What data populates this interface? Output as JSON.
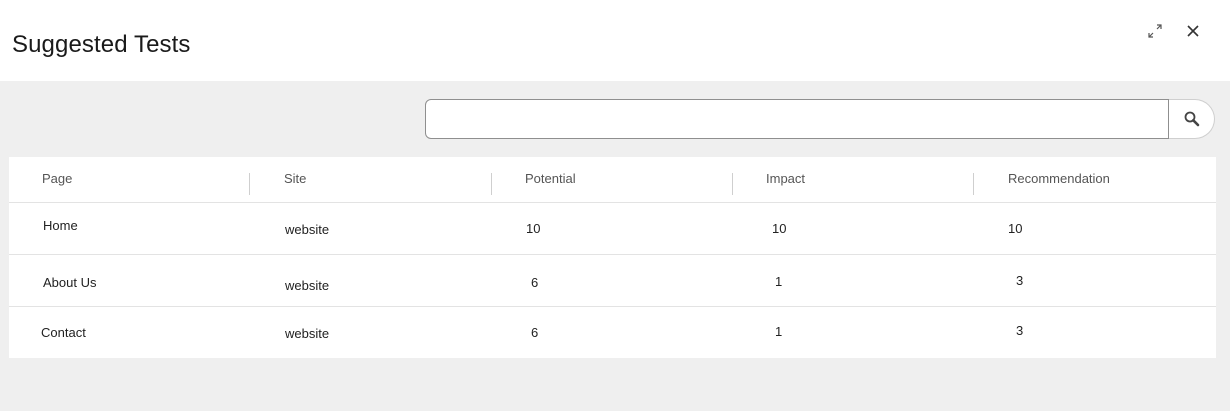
{
  "header": {
    "title": "Suggested Tests"
  },
  "search": {
    "value": "",
    "placeholder": ""
  },
  "table": {
    "columns": [
      "Page",
      "Site",
      "Potential",
      "Impact",
      "Recommendation"
    ],
    "rows": [
      {
        "page": "Home",
        "site": "website",
        "potential": "10",
        "impact": "10",
        "recommendation": "10"
      },
      {
        "page": "About Us",
        "site": "website",
        "potential": "6",
        "impact": "1",
        "recommendation": "3"
      },
      {
        "page": "Contact",
        "site": "website",
        "potential": "6",
        "impact": "1",
        "recommendation": "3"
      }
    ]
  },
  "icons": {
    "expand": "expand-icon",
    "close": "close-icon",
    "search": "search-icon"
  },
  "colors": {
    "background": "#efefef",
    "panel": "#ffffff",
    "border": "#8f8f8f"
  }
}
